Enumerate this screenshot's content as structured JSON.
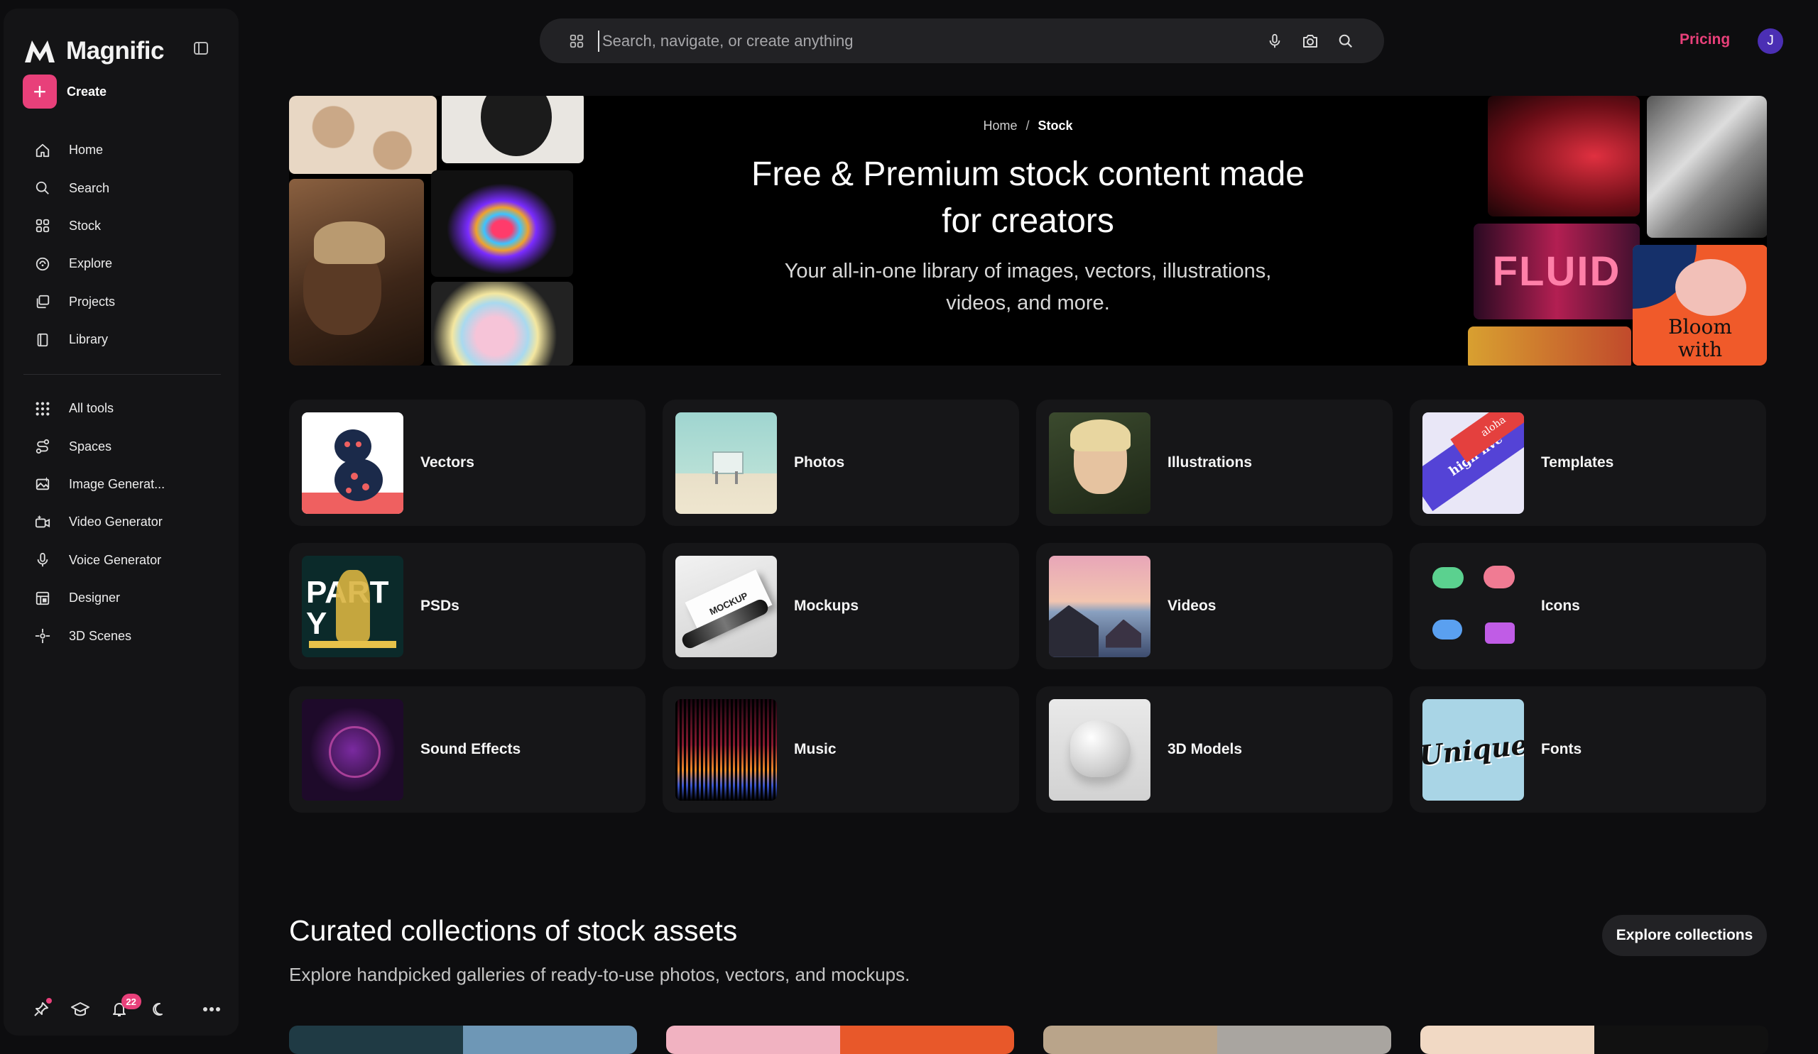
{
  "app": {
    "name": "Magnific"
  },
  "sidebar": {
    "create_label": "Create",
    "primary_items": [
      {
        "label": "Home",
        "icon": "home-icon"
      },
      {
        "label": "Search",
        "icon": "search-icon"
      },
      {
        "label": "Stock",
        "icon": "stock-icon"
      },
      {
        "label": "Explore",
        "icon": "explore-icon"
      },
      {
        "label": "Projects",
        "icon": "projects-icon"
      },
      {
        "label": "Library",
        "icon": "library-icon"
      }
    ],
    "tool_items": [
      {
        "label": "All tools",
        "icon": "grid-icon"
      },
      {
        "label": "Spaces",
        "icon": "spaces-icon"
      },
      {
        "label": "Image Generat...",
        "icon": "image-icon"
      },
      {
        "label": "Video Generator",
        "icon": "video-icon"
      },
      {
        "label": "Voice Generator",
        "icon": "microphone-icon"
      },
      {
        "label": "Designer",
        "icon": "designer-icon"
      },
      {
        "label": "3D Scenes",
        "icon": "3d-icon"
      }
    ],
    "notifications_count": "22"
  },
  "search": {
    "placeholder": "Search, navigate, or create anything"
  },
  "header": {
    "pricing_label": "Pricing",
    "avatar_initial": "J"
  },
  "hero": {
    "breadcrumb": {
      "home": "Home",
      "separator": "/",
      "current": "Stock"
    },
    "title_line1": "Free & Premium stock content made",
    "title_line2": "for creators",
    "subtitle_line1": "Your all-in-one library of images, vectors, illustrations,",
    "subtitle_line2": "videos, and more.",
    "art_text_fluid": "FLUID",
    "art_text_bloom": "Bloom with"
  },
  "categories": [
    {
      "label": "Vectors"
    },
    {
      "label": "Photos"
    },
    {
      "label": "Illustrations"
    },
    {
      "label": "Templates"
    },
    {
      "label": "PSDs"
    },
    {
      "label": "Mockups"
    },
    {
      "label": "Videos"
    },
    {
      "label": "Icons"
    },
    {
      "label": "Sound Effects"
    },
    {
      "label": "Music"
    },
    {
      "label": "3D Models"
    },
    {
      "label": "Fonts"
    }
  ],
  "thumb_text": {
    "templates": "high five",
    "templates_small": "aloha",
    "psds": "PARTY",
    "mockups": "MOCKUP",
    "fonts": "Unique"
  },
  "collections": {
    "title": "Curated collections of stock assets",
    "subtitle": "Explore handpicked galleries of ready-to-use photos, vectors, and mockups.",
    "explore_label": "Explore collections"
  },
  "colors": {
    "accent": "#e8407a",
    "background": "#0d0d0f",
    "sidebar": "#141416",
    "card": "#161618",
    "avatar": "#4b2fb4"
  }
}
